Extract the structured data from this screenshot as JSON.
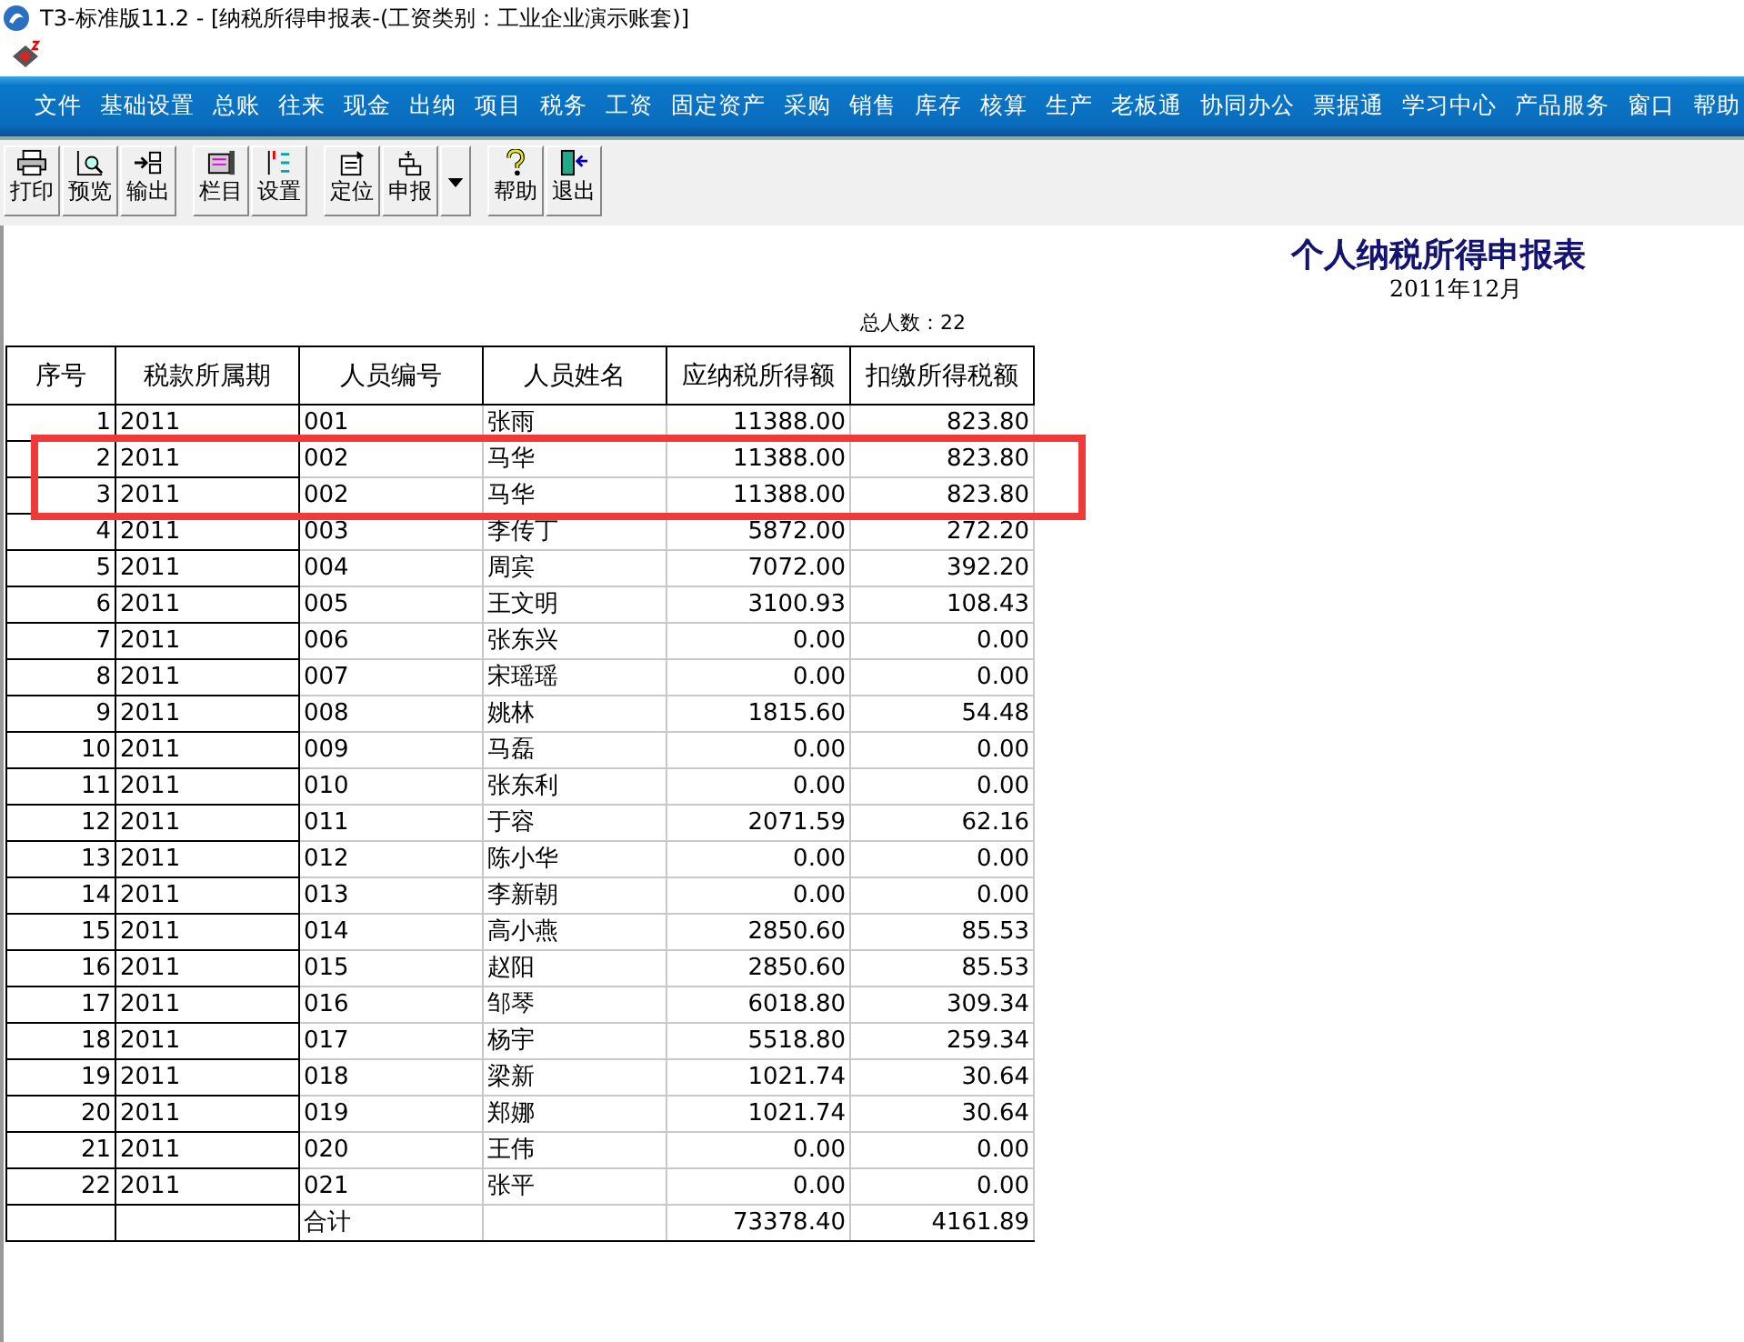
{
  "window": {
    "title": "T3-标准版11.2 - [纳税所得申报表-(工资类别：工业企业演示账套)]"
  },
  "menu": [
    "文件",
    "基础设置",
    "总账",
    "往来",
    "现金",
    "出纳",
    "项目",
    "税务",
    "工资",
    "固定资产",
    "采购",
    "销售",
    "库存",
    "核算",
    "生产",
    "老板通",
    "协同办公",
    "票据通",
    "学习中心",
    "产品服务",
    "窗口",
    "帮助"
  ],
  "toolbar": [
    {
      "buttons": [
        {
          "label": "打印",
          "kind": "printer"
        },
        {
          "label": "预览",
          "kind": "preview"
        },
        {
          "label": "输出",
          "kind": "export"
        }
      ]
    },
    {
      "buttons": [
        {
          "label": "栏目",
          "kind": "columns"
        },
        {
          "label": "设置",
          "kind": "settings"
        }
      ]
    },
    {
      "buttons": [
        {
          "label": "定位",
          "kind": "locate"
        },
        {
          "label": "申报",
          "kind": "declare"
        },
        {
          "kind": "dropdown"
        }
      ]
    },
    {
      "buttons": [
        {
          "label": "帮助",
          "kind": "help"
        },
        {
          "label": "退出",
          "kind": "exit"
        }
      ]
    }
  ],
  "report": {
    "title": "个人纳税所得申报表",
    "period": "2011年12月",
    "count": "总人数：22"
  },
  "table": {
    "columns": [
      "序号",
      "税款所属期",
      "人员编号",
      "人员姓名",
      "应纳税所得额",
      "扣缴所得税额"
    ],
    "rows": [
      {
        "cells": [
          "1",
          "2011",
          "001",
          "张雨",
          "11388.00",
          "823.80"
        ],
        "highlighted": false
      },
      {
        "cells": [
          "2",
          "2011",
          "002",
          "马华",
          "11388.00",
          "823.80"
        ],
        "highlighted": true
      },
      {
        "cells": [
          "3",
          "2011",
          "002",
          "马华",
          "11388.00",
          "823.80"
        ],
        "highlighted": true
      },
      {
        "cells": [
          "4",
          "2011",
          "003",
          "李传丁",
          "5872.00",
          "272.20"
        ],
        "highlighted": false
      },
      {
        "cells": [
          "5",
          "2011",
          "004",
          "周宾",
          "7072.00",
          "392.20"
        ],
        "highlighted": false
      },
      {
        "cells": [
          "6",
          "2011",
          "005",
          "王文明",
          "3100.93",
          "108.43"
        ],
        "highlighted": false
      },
      {
        "cells": [
          "7",
          "2011",
          "006",
          "张东兴",
          "0.00",
          "0.00"
        ],
        "highlighted": false
      },
      {
        "cells": [
          "8",
          "2011",
          "007",
          "宋瑶瑶",
          "0.00",
          "0.00"
        ],
        "highlighted": false
      },
      {
        "cells": [
          "9",
          "2011",
          "008",
          "姚林",
          "1815.60",
          "54.48"
        ],
        "highlighted": false
      },
      {
        "cells": [
          "10",
          "2011",
          "009",
          "马磊",
          "0.00",
          "0.00"
        ],
        "highlighted": false
      },
      {
        "cells": [
          "11",
          "2011",
          "010",
          "张东利",
          "0.00",
          "0.00"
        ],
        "highlighted": false
      },
      {
        "cells": [
          "12",
          "2011",
          "011",
          "于容",
          "2071.59",
          "62.16"
        ],
        "highlighted": false
      },
      {
        "cells": [
          "13",
          "2011",
          "012",
          "陈小华",
          "0.00",
          "0.00"
        ],
        "highlighted": false
      },
      {
        "cells": [
          "14",
          "2011",
          "013",
          "李新朝",
          "0.00",
          "0.00"
        ],
        "highlighted": false
      },
      {
        "cells": [
          "15",
          "2011",
          "014",
          "高小燕",
          "2850.60",
          "85.53"
        ],
        "highlighted": false
      },
      {
        "cells": [
          "16",
          "2011",
          "015",
          "赵阳",
          "2850.60",
          "85.53"
        ],
        "highlighted": false
      },
      {
        "cells": [
          "17",
          "2011",
          "016",
          "邹琴",
          "6018.80",
          "309.34"
        ],
        "highlighted": false
      },
      {
        "cells": [
          "18",
          "2011",
          "017",
          "杨宇",
          "5518.80",
          "259.34"
        ],
        "highlighted": false
      },
      {
        "cells": [
          "19",
          "2011",
          "018",
          "梁新",
          "1021.74",
          "30.64"
        ],
        "highlighted": false
      },
      {
        "cells": [
          "20",
          "2011",
          "019",
          "郑娜",
          "1021.74",
          "30.64"
        ],
        "highlighted": false
      },
      {
        "cells": [
          "21",
          "2011",
          "020",
          "王伟",
          "0.00",
          "0.00"
        ],
        "highlighted": false
      },
      {
        "cells": [
          "22",
          "2011",
          "021",
          "张平",
          "0.00",
          "0.00"
        ],
        "highlighted": false
      }
    ],
    "total": {
      "label": "合计",
      "taxable": "73378.40",
      "tax": "4161.89"
    }
  }
}
